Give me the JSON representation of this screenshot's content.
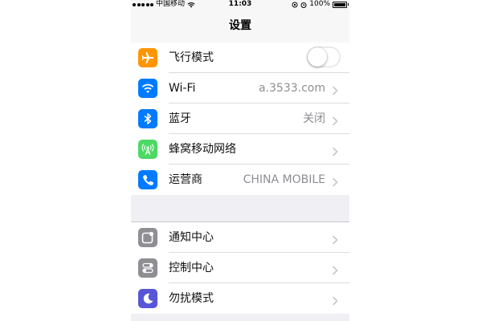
{
  "status_bar": {
    "carrier": "中国移动",
    "time": "11:03",
    "battery": "100%"
  },
  "nav": {
    "title": "设置"
  },
  "group1": [
    {
      "id": "airplane",
      "label": "飞行模式",
      "icon": "airplane-icon",
      "color": "#ff9500",
      "control": "toggle",
      "toggle_on": false
    },
    {
      "id": "wifi",
      "label": "Wi-Fi",
      "value": "a.3533.com",
      "icon": "wifi-icon",
      "color": "#007aff"
    },
    {
      "id": "bluetooth",
      "label": "蓝牙",
      "value": "关闭",
      "icon": "bluetooth-icon",
      "color": "#007aff"
    },
    {
      "id": "cellular",
      "label": "蜂窝移动网络",
      "value": "",
      "icon": "cellular-icon",
      "color": "#4cd964"
    },
    {
      "id": "carrier",
      "label": "运营商",
      "value": "CHINA MOBILE",
      "icon": "phone-icon",
      "color": "#007aff"
    }
  ],
  "group2": [
    {
      "id": "notification",
      "label": "通知中心",
      "icon": "notification-center-icon",
      "color": "#8e8e93"
    },
    {
      "id": "control",
      "label": "控制中心",
      "icon": "control-center-icon",
      "color": "#8e8e93"
    },
    {
      "id": "dnd",
      "label": "勿扰模式",
      "icon": "moon-icon",
      "color": "#5856d6"
    }
  ]
}
